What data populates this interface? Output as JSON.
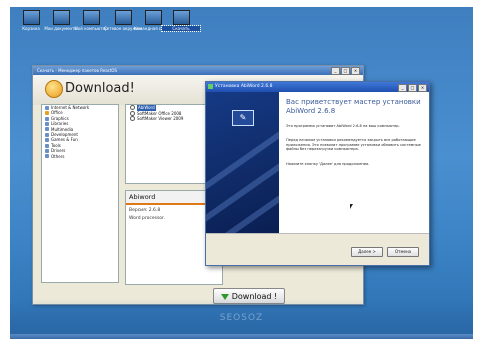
{
  "desktop": {
    "icons": [
      {
        "label": "Корзина"
      },
      {
        "label": "Мои документы"
      },
      {
        "label": "Мой компьютер"
      },
      {
        "label": "Сетевое окружение"
      },
      {
        "label": "Командная строка"
      },
      {
        "label": "Скачать"
      }
    ],
    "watermark": "SEOSOZ"
  },
  "app": {
    "window_title": "Скачать - Менеджер пакетов ReactOS",
    "header_title": "Download!",
    "categories": [
      "Internet & Network",
      "Office",
      "Graphics",
      "Libraries",
      "Multimedia",
      "Development",
      "Games & Fun",
      "Tools",
      "Drivers",
      "Others"
    ],
    "programs": [
      "AbiWord",
      "SoftMaker Office 2008",
      "SoftMaker Viewer 2009"
    ],
    "info": {
      "name": "Abiword",
      "version": "Версия: 2.6.8",
      "description": "Word processor."
    },
    "download_button": "Download !"
  },
  "installer": {
    "title": "Установка AbiWord 2.6.8",
    "heading": "Вас приветствует мастер установки AbiWord 2.6.8",
    "text1": "Эта программа установит AbiWord 2.6.8 на ваш компьютер.",
    "text2": "Перед началом установки рекомендуется закрыть все работающие приложения. Это позволит программе установки обновить системные файлы без перезагрузки компьютера.",
    "text3": "Нажмите кнопку 'Далее' для продолжения.",
    "next_button": "Далее >",
    "cancel_button": "Отмена"
  }
}
